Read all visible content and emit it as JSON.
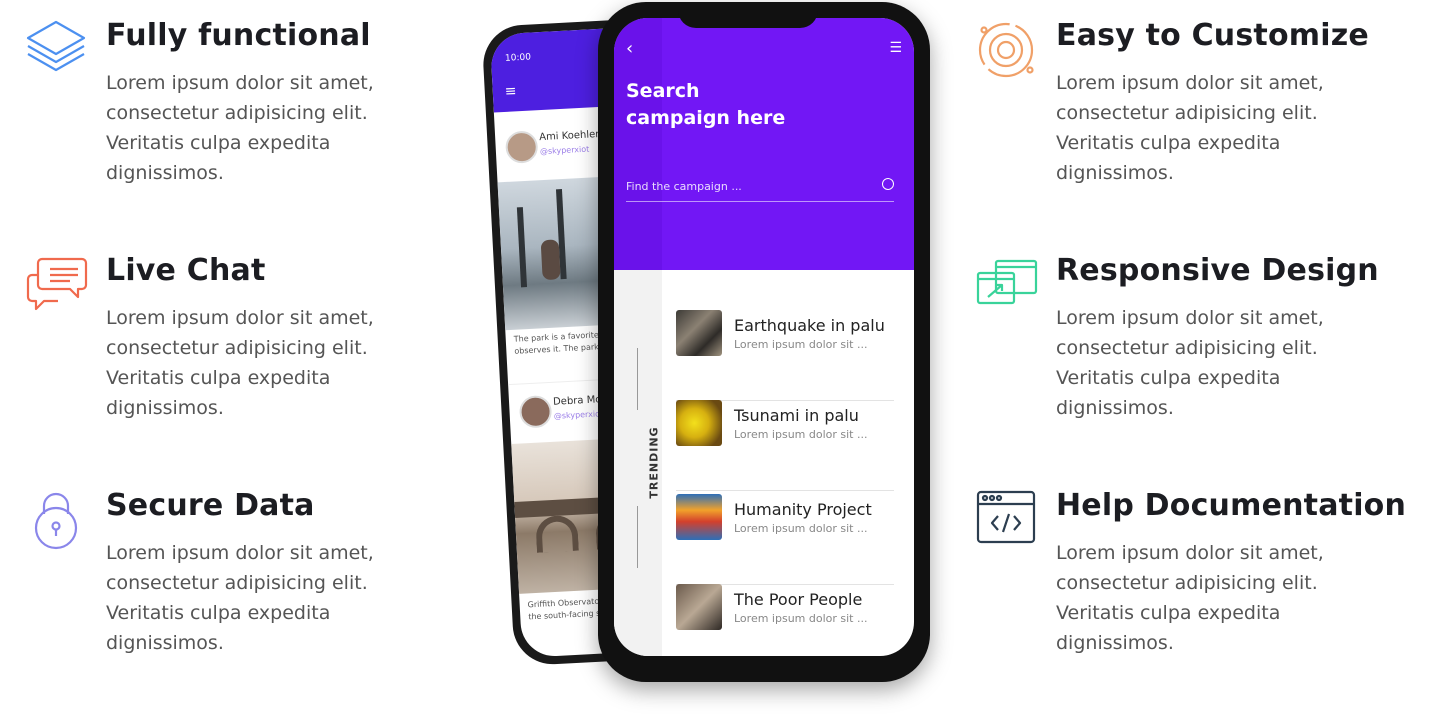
{
  "features_left": [
    {
      "title": "Fully functional",
      "desc": "Lorem ipsum dolor sit amet, consectetur adipisicing elit. Veritatis culpa expedita dignissimos.",
      "icon": "layers-icon",
      "color": "#4c90f0"
    },
    {
      "title": "Live Chat",
      "desc": "Lorem ipsum dolor sit amet, consectetur adipisicing elit. Veritatis culpa expedita dignissimos.",
      "icon": "chat-icon",
      "color": "#f06a4d"
    },
    {
      "title": "Secure Data",
      "desc": "Lorem ipsum dolor sit amet, consectetur adipisicing elit. Veritatis culpa expedita dignissimos.",
      "icon": "lock-icon",
      "color": "#8a86ea"
    }
  ],
  "features_right": [
    {
      "title": "Easy to Customize",
      "desc": "Lorem ipsum dolor sit amet, consectetur adipisicing elit. Veritatis culpa expedita dignissimos.",
      "icon": "gear-icon",
      "color": "#f0a068"
    },
    {
      "title": "Responsive Design",
      "desc": "Lorem ipsum dolor sit amet, consectetur adipisicing elit. Veritatis culpa expedita dignissimos.",
      "icon": "responsive-icon",
      "color": "#39d39a"
    },
    {
      "title": "Help Documentation",
      "desc": "Lorem ipsum dolor sit amet, consectetur adipisicing elit. Veritatis culpa expedita dignissimos.",
      "icon": "code-window-icon",
      "color": "#2c3e50"
    }
  ],
  "phone": {
    "search_title": "Search campaign here",
    "search_placeholder": "Find the campaign ...",
    "trending_label": "TRENDING",
    "items": [
      {
        "title": "Earthquake in palu",
        "sub": "Lorem ipsum dolor sit ..."
      },
      {
        "title": "Tsunami in palu",
        "sub": "Lorem ipsum dolor sit ..."
      },
      {
        "title": "Humanity Project",
        "sub": "Lorem ipsum dolor sit ..."
      },
      {
        "title": "The Poor People",
        "sub": "Lorem ipsum dolor sit ..."
      }
    ],
    "back": {
      "time": "10:00",
      "user1": "Ami Koehler",
      "handle1": "@skyperxiot",
      "caption1": "The park is a favorite among skat... observes it. The park is complete...",
      "user2": "Debra Mcmunn",
      "handle2": "@skyperxiot",
      "caption2": "Griffith Observatory is a facility in ... the south-facing slope of Moun..."
    }
  }
}
